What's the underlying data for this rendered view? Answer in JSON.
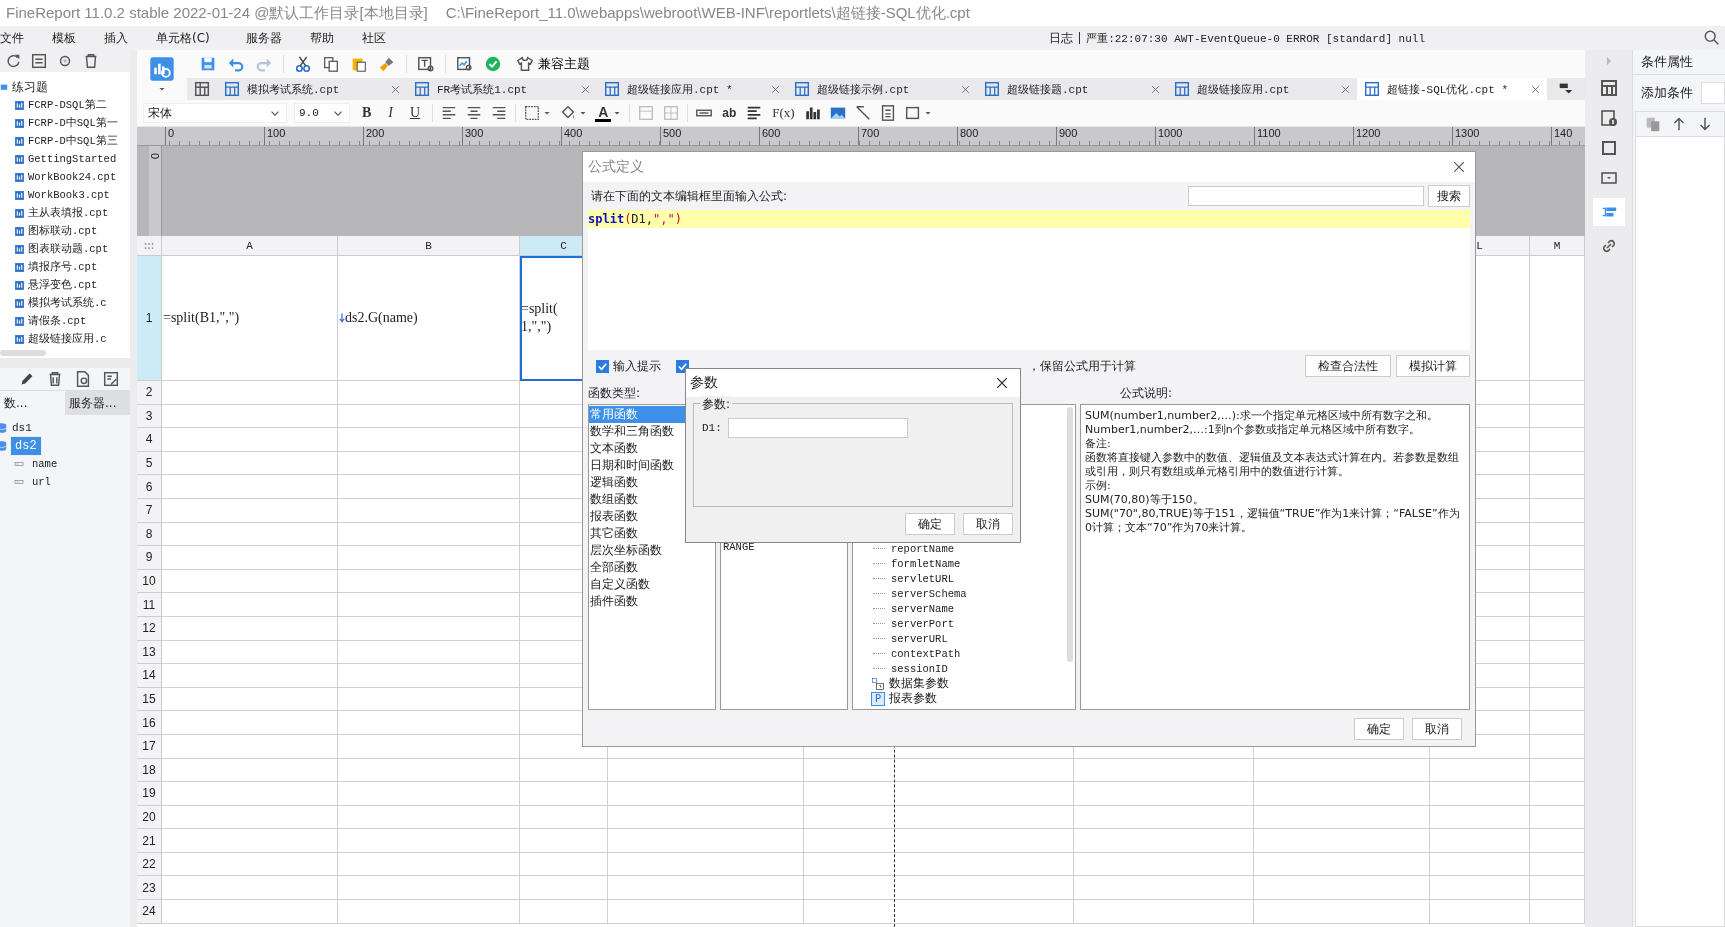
{
  "title_bar": {
    "app": "FineReport 11.0.2 stable 2022-01-24 @默认工作目录[本地目录]",
    "path": "C:\\FineReport_11.0\\webapps\\webroot\\WEB-INF\\reportlets\\超链接-SQL优化.cpt"
  },
  "menu_bar": {
    "items": [
      "文件",
      "模板",
      "插入",
      "单元格(C)",
      "服务器",
      "帮助",
      "社区"
    ],
    "log_label": "日志",
    "log_message": "严重:22:07:30 AWT-EventQueue-0 ERROR [standard] null"
  },
  "left_panel": {
    "tree": {
      "label": "练习题",
      "children": [
        {
          "label": "FCRP-DSQL第二"
        },
        {
          "label": "FCRP-D中SQL第一"
        },
        {
          "label": "FCRP-D中SQL第三"
        },
        {
          "label": "GettingStarted"
        },
        {
          "label": "WorkBook24.cpt"
        },
        {
          "label": "WorkBook3.cpt"
        },
        {
          "label": "主从表填报.cpt"
        },
        {
          "label": "图标联动.cpt"
        },
        {
          "label": "图表联动题.cpt"
        },
        {
          "label": "填报序号.cpt"
        },
        {
          "label": "悬浮变色.cpt"
        },
        {
          "label": "模拟考试系统.c"
        },
        {
          "label": "请假条.cpt"
        },
        {
          "label": "超级链接应用.c"
        }
      ]
    },
    "dataset_tabs": [
      {
        "label": "数...",
        "selected": true
      },
      {
        "label": "服务器...",
        "selected": false
      }
    ],
    "datasets": [
      {
        "label": "ds1",
        "selected": false
      },
      {
        "label": "ds2",
        "selected": true,
        "children": [
          {
            "label": "name"
          },
          {
            "label": "url"
          }
        ]
      }
    ]
  },
  "toolbar": {
    "theme_button": "兼容主题"
  },
  "tabs": [
    {
      "label": "模拟考试系统.cpt",
      "selected": false
    },
    {
      "label": "FR考试系统1.cpt",
      "selected": false
    },
    {
      "label": "超级链接应用.cpt *",
      "selected": false
    },
    {
      "label": "超级链接示例.cpt",
      "selected": false
    },
    {
      "label": "超级链接题.cpt",
      "selected": false
    },
    {
      "label": "超级链接应用.cpt",
      "selected": false
    },
    {
      "label": "超链接-SQL优化.cpt *",
      "selected": true
    }
  ],
  "format_bar": {
    "font": "宋体",
    "size": "9.0",
    "style_buttons": [
      "B",
      "I",
      "U"
    ],
    "font_color": "A",
    "text_tool": "ab",
    "formula_tool": "F(x)"
  },
  "ruler": {
    "labels": [
      "0",
      "100",
      "200",
      "300",
      "400",
      "500",
      "600",
      "700",
      "800",
      "900",
      "1000",
      "1100",
      "1200",
      "1300",
      "140"
    ],
    "vertical_label": "0"
  },
  "sheet": {
    "columns": [
      {
        "label": "A",
        "selected": false
      },
      {
        "label": "B",
        "selected": false
      },
      {
        "label": "C",
        "selected": true
      },
      {
        "label": "L",
        "selected": false
      },
      {
        "label": "M",
        "selected": false
      }
    ],
    "rows": [
      {
        "number": "1",
        "selected": true,
        "cells": [
          {
            "lines": [
              "=split(B1,\",\")"
            ],
            "kind": "plain"
          },
          {
            "lines": [
              "ds2.G(name)"
            ],
            "kind": "expand"
          },
          {
            "lines": [
              "=split(",
              "1,\",\")"
            ],
            "kind": "plain"
          }
        ]
      },
      {
        "number": "2",
        "selected": false
      },
      {
        "number": "3",
        "selected": false
      },
      {
        "number": "4",
        "selected": false
      },
      {
        "number": "5",
        "selected": false
      },
      {
        "number": "6",
        "selected": false
      },
      {
        "number": "7",
        "selected": false
      },
      {
        "number": "8",
        "selected": false
      },
      {
        "number": "9",
        "selected": false
      },
      {
        "number": "10",
        "selected": false
      },
      {
        "number": "11",
        "selected": false
      },
      {
        "number": "12",
        "selected": false
      },
      {
        "number": "13",
        "selected": false
      },
      {
        "number": "14",
        "selected": false
      },
      {
        "number": "15",
        "selected": false
      },
      {
        "number": "16",
        "selected": false
      },
      {
        "number": "17",
        "selected": false
      },
      {
        "number": "18",
        "selected": false
      },
      {
        "number": "19",
        "selected": false
      },
      {
        "number": "20",
        "selected": false
      },
      {
        "number": "21",
        "selected": false
      },
      {
        "number": "22",
        "selected": false
      },
      {
        "number": "23",
        "selected": false
      },
      {
        "number": "24",
        "selected": false
      }
    ]
  },
  "right_panel": {
    "title": "条件属性",
    "add_condition": "添加条件"
  },
  "formula_dialog": {
    "title": "公式定义",
    "prompt": "请在下面的文本编辑框里面输入公式:",
    "search_button": "搜索",
    "formula": [
      {
        "text": "split",
        "kind": "function"
      },
      {
        "text": "(",
        "kind": "paren"
      },
      {
        "text": "D1,",
        "kind": "plain"
      },
      {
        "text": "\",\"",
        "kind": "string"
      },
      {
        "text": ")",
        "kind": "paren"
      }
    ],
    "input_hint": {
      "label": "输入提示",
      "checked": true
    },
    "second_option": {
      "checked": true
    },
    "keep_formula_text": "，保留公式用于计算",
    "check_button": "检查合法性",
    "simulate_button": "模拟计算",
    "function_type_label": "函数类型:",
    "function_types": [
      {
        "label": "常用函数",
        "selected": true
      },
      {
        "label": "数学和三角函数",
        "selected": false
      },
      {
        "label": "文本函数",
        "selected": false
      },
      {
        "label": "日期和时间函数",
        "selected": false
      },
      {
        "label": "逻辑函数",
        "selected": false
      },
      {
        "label": "数组函数",
        "selected": false
      },
      {
        "label": "报表函数",
        "selected": false
      },
      {
        "label": "其它函数",
        "selected": false
      },
      {
        "label": "层次坐标函数",
        "selected": false
      },
      {
        "label": "全部函数",
        "selected": false
      },
      {
        "label": "自定义函数",
        "selected": false
      },
      {
        "label": "插件函数",
        "selected": false
      }
    ],
    "functions": [
      "RANGE"
    ],
    "variables": [
      {
        "label": "reportName",
        "kind": "variable"
      },
      {
        "label": "formletName",
        "kind": "variable"
      },
      {
        "label": "servletURL",
        "kind": "variable"
      },
      {
        "label": "serverSchema",
        "kind": "variable"
      },
      {
        "label": "serverName",
        "kind": "variable"
      },
      {
        "label": "serverPort",
        "kind": "variable"
      },
      {
        "label": "serverURL",
        "kind": "variable"
      },
      {
        "label": "contextPath",
        "kind": "variable"
      },
      {
        "label": "sessionID",
        "kind": "variable"
      },
      {
        "label": "数据集参数",
        "kind": "dataset"
      },
      {
        "label": "报表参数",
        "kind": "report",
        "badge": "P"
      }
    ],
    "description_label": "公式说明:",
    "description": [
      "SUM(number1,number2,…):求一个指定单元格区域中所有数字之和。",
      "Number1,number2,…:1到n个参数或指定单元格区域中所有数字。",
      "备注:",
      "函数将直接键入参数中的数值、逻辑值及文本表达式计算在内。若参数是数组或引用，则只有数组或单元格引用中的数值进行计算。",
      "示例:",
      "SUM(70,80)等于150。",
      "SUM(\"70\",80,TRUE)等于151，逻辑值“TRUE”作为1来计算；“FALSE”作为0计算；文本“70”作为70来计算。"
    ],
    "ok_button": "确定",
    "cancel_button": "取消"
  },
  "param_dialog": {
    "title": "参数",
    "group_label": "参数:",
    "field_label": "D1:",
    "ok_button": "确定",
    "cancel_button": "取消"
  }
}
